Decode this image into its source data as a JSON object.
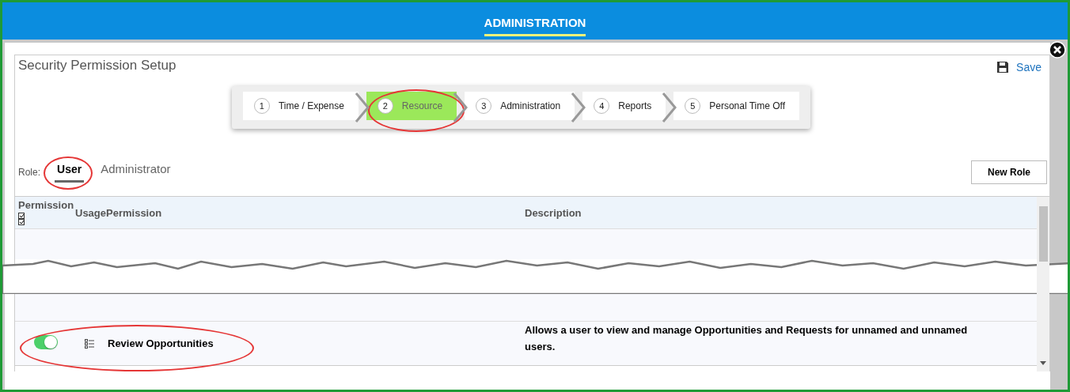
{
  "top_bar": {
    "tabs": [
      {
        "label": "ADMINISTRATION",
        "selected": true
      }
    ]
  },
  "panel": {
    "title": "Security Permission Setup",
    "save_label": "Save"
  },
  "wizard": {
    "steps": [
      {
        "number": "1",
        "label": "Time / Expense",
        "selected": false
      },
      {
        "number": "2",
        "label": "Resource",
        "selected": true
      },
      {
        "number": "3",
        "label": "Administration",
        "selected": false
      },
      {
        "number": "4",
        "label": "Reports",
        "selected": false
      },
      {
        "number": "5",
        "label": "Personal Time Off",
        "selected": false
      }
    ]
  },
  "role": {
    "label": "Role:",
    "tabs": [
      {
        "label": "User",
        "selected": true
      },
      {
        "label": "Administrator",
        "selected": false
      }
    ],
    "new_role_button": "New Role"
  },
  "table": {
    "columns": [
      "Permission",
      "UsagePermission",
      "Description"
    ],
    "rows": [
      {
        "on": true,
        "name": "Review Opportunities",
        "description": "Allows a user to view and manage Opportunities and Requests for unnamed and unnamed users."
      }
    ]
  }
}
